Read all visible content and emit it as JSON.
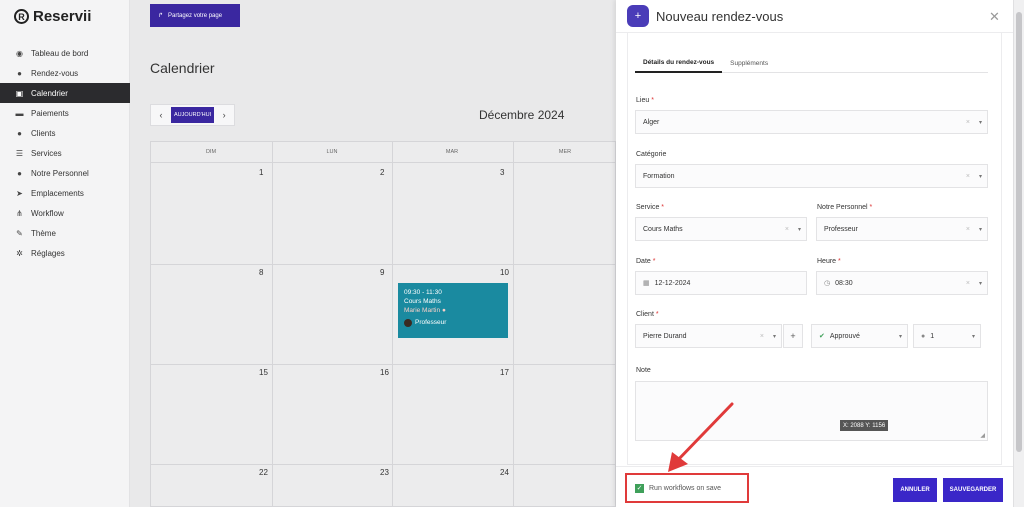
{
  "brand": {
    "name": "Reservii",
    "mark": "R"
  },
  "sidebar": {
    "items": [
      {
        "label": "Tableau de bord",
        "icon": "palette-icon",
        "glyph": "◉"
      },
      {
        "label": "Rendez-vous",
        "icon": "clock-icon",
        "glyph": "●"
      },
      {
        "label": "Calendrier",
        "icon": "calendar-icon",
        "glyph": "▣"
      },
      {
        "label": "Paiements",
        "icon": "credit-card-icon",
        "glyph": "▬"
      },
      {
        "label": "Clients",
        "icon": "users-icon",
        "glyph": "●"
      },
      {
        "label": "Services",
        "icon": "list-icon",
        "glyph": "☰"
      },
      {
        "label": "Notre Personnel",
        "icon": "user-tie-icon",
        "glyph": "●"
      },
      {
        "label": "Emplacements",
        "icon": "location-arrow-icon",
        "glyph": "➤"
      },
      {
        "label": "Workflow",
        "icon": "workflow-icon",
        "glyph": "⋔"
      },
      {
        "label": "Thème",
        "icon": "brush-icon",
        "glyph": "✎"
      },
      {
        "label": "Réglages",
        "icon": "gear-icon",
        "glyph": "✲"
      }
    ],
    "active_index": 2
  },
  "header": {
    "share_label": "Partagez votre page",
    "share_glyph": "↱"
  },
  "calendar": {
    "page_title": "Calendrier",
    "today_label": "AUJOURD'HUI",
    "prev_glyph": "‹",
    "next_glyph": "›",
    "month_title": "Décembre 2024",
    "weekdays": [
      "DIM",
      "LUN",
      "MAR",
      "MER"
    ],
    "rows": [
      [
        "1",
        "2",
        "3"
      ],
      [
        "8",
        "9",
        "10"
      ],
      [
        "15",
        "16",
        "17"
      ],
      [
        "22",
        "23",
        "24"
      ]
    ],
    "event": {
      "time": "09:30 - 11:30",
      "service": "Cours Maths",
      "client": "Marie Martin",
      "client_flag": "●",
      "staff": "Professeur"
    }
  },
  "modal": {
    "title": "Nouveau rendez-vous",
    "icon_glyph": "+",
    "close_glyph": "✕",
    "tabs": [
      "Détails du rendez-vous",
      "Suppléments"
    ],
    "fields": {
      "lieu": {
        "label": "Lieu",
        "value": "Alger"
      },
      "categorie": {
        "label": "Catégorie",
        "value": "Formation"
      },
      "service": {
        "label": "Service",
        "value": "Cours Maths"
      },
      "personnel": {
        "label": "Notre Personnel",
        "value": "Professeur"
      },
      "date": {
        "label": "Date",
        "value": "12-12-2024"
      },
      "heure": {
        "label": "Heure",
        "value": "08:30"
      },
      "client": {
        "label": "Client",
        "value": "Pierre Durand"
      },
      "status": {
        "value": "Approuvé"
      },
      "count": {
        "value": "1"
      },
      "note": {
        "label": "Note",
        "value": ""
      }
    },
    "required_mark": "*",
    "clear_glyph": "×",
    "caret_glyph": "▾",
    "plus_glyph": "+",
    "coords_overlay": "X: 2088 Y: 1156",
    "footer": {
      "run_workflows_label": "Run workflows on save",
      "run_workflows_checked": true,
      "cancel_label": "ANNULER",
      "save_label": "SAUVEGARDER"
    }
  },
  "colors": {
    "accent": "#3a27c8",
    "event_bg": "#1a8aa0",
    "annotation": "#e03a3a",
    "checkbox": "#3fa05a"
  }
}
